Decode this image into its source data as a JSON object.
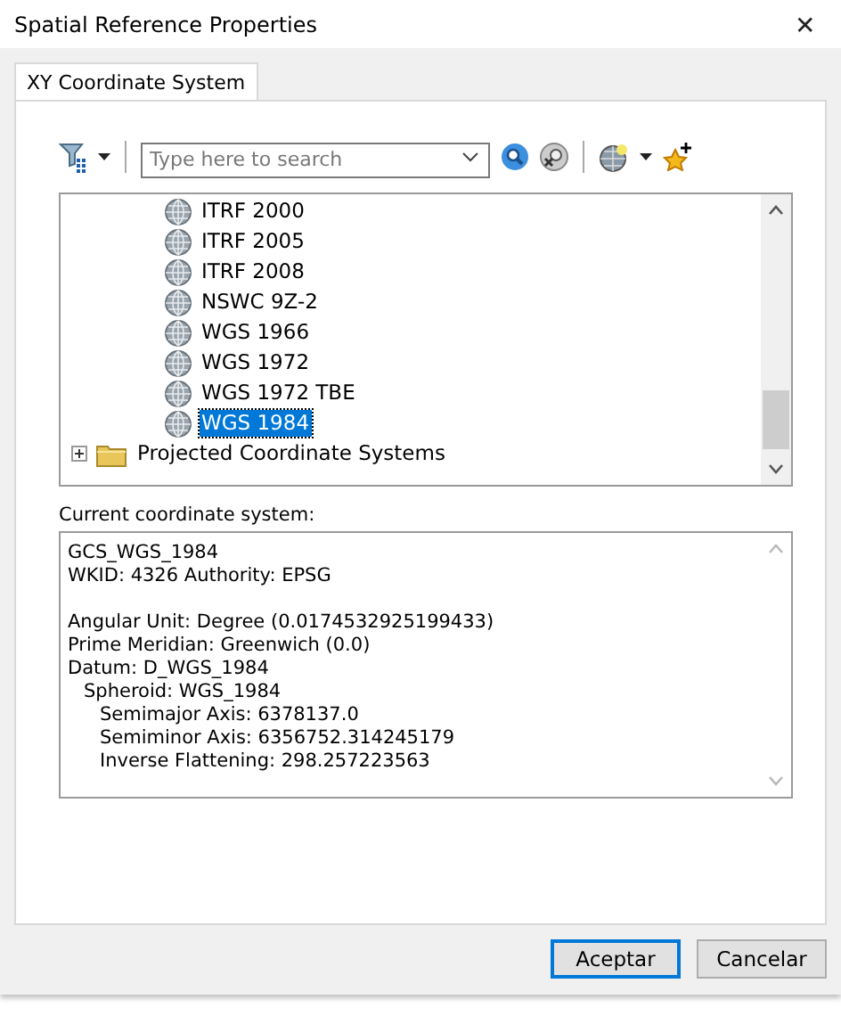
{
  "window": {
    "title": "Spatial Reference Properties",
    "close": "✕"
  },
  "tabs": [
    {
      "label": "XY Coordinate System",
      "selected": true
    }
  ],
  "search": {
    "placeholder": "Type here to search"
  },
  "tree": [
    {
      "kind": "globe",
      "label": "ITRF 2000",
      "selected": false
    },
    {
      "kind": "globe",
      "label": "ITRF 2005",
      "selected": false
    },
    {
      "kind": "globe",
      "label": "ITRF 2008",
      "selected": false
    },
    {
      "kind": "globe",
      "label": "NSWC 9Z-2",
      "selected": false
    },
    {
      "kind": "globe",
      "label": "WGS 1966",
      "selected": false
    },
    {
      "kind": "globe",
      "label": "WGS 1972",
      "selected": false
    },
    {
      "kind": "globe",
      "label": "WGS 1972 TBE",
      "selected": false
    },
    {
      "kind": "globe",
      "label": "WGS 1984",
      "selected": true
    },
    {
      "kind": "folder",
      "label": "Projected Coordinate Systems",
      "selected": false,
      "expanded": false
    }
  ],
  "current": {
    "label": "Current coordinate system:",
    "blocks": [
      {
        "lines": [
          {
            "text": "GCS_WGS_1984"
          },
          {
            "text": "WKID: 4326 Authority: EPSG"
          }
        ]
      },
      {
        "lines": [
          {
            "text": "Angular Unit: Degree (0.0174532925199433)"
          },
          {
            "text": "Prime Meridian: Greenwich (0.0)"
          },
          {
            "text": "Datum: D_WGS_1984",
            "children": [
              {
                "text": "Spheroid: WGS_1984",
                "children": [
                  {
                    "text": "Semimajor Axis: 6378137.0"
                  },
                  {
                    "text": "Semiminor Axis: 6356752.314245179"
                  },
                  {
                    "text": "Inverse Flattening: 298.257223563"
                  }
                ]
              }
            ]
          }
        ]
      }
    ]
  },
  "buttons": [
    {
      "label": "Aceptar",
      "default": true
    },
    {
      "label": "Cancelar",
      "default": false
    }
  ]
}
